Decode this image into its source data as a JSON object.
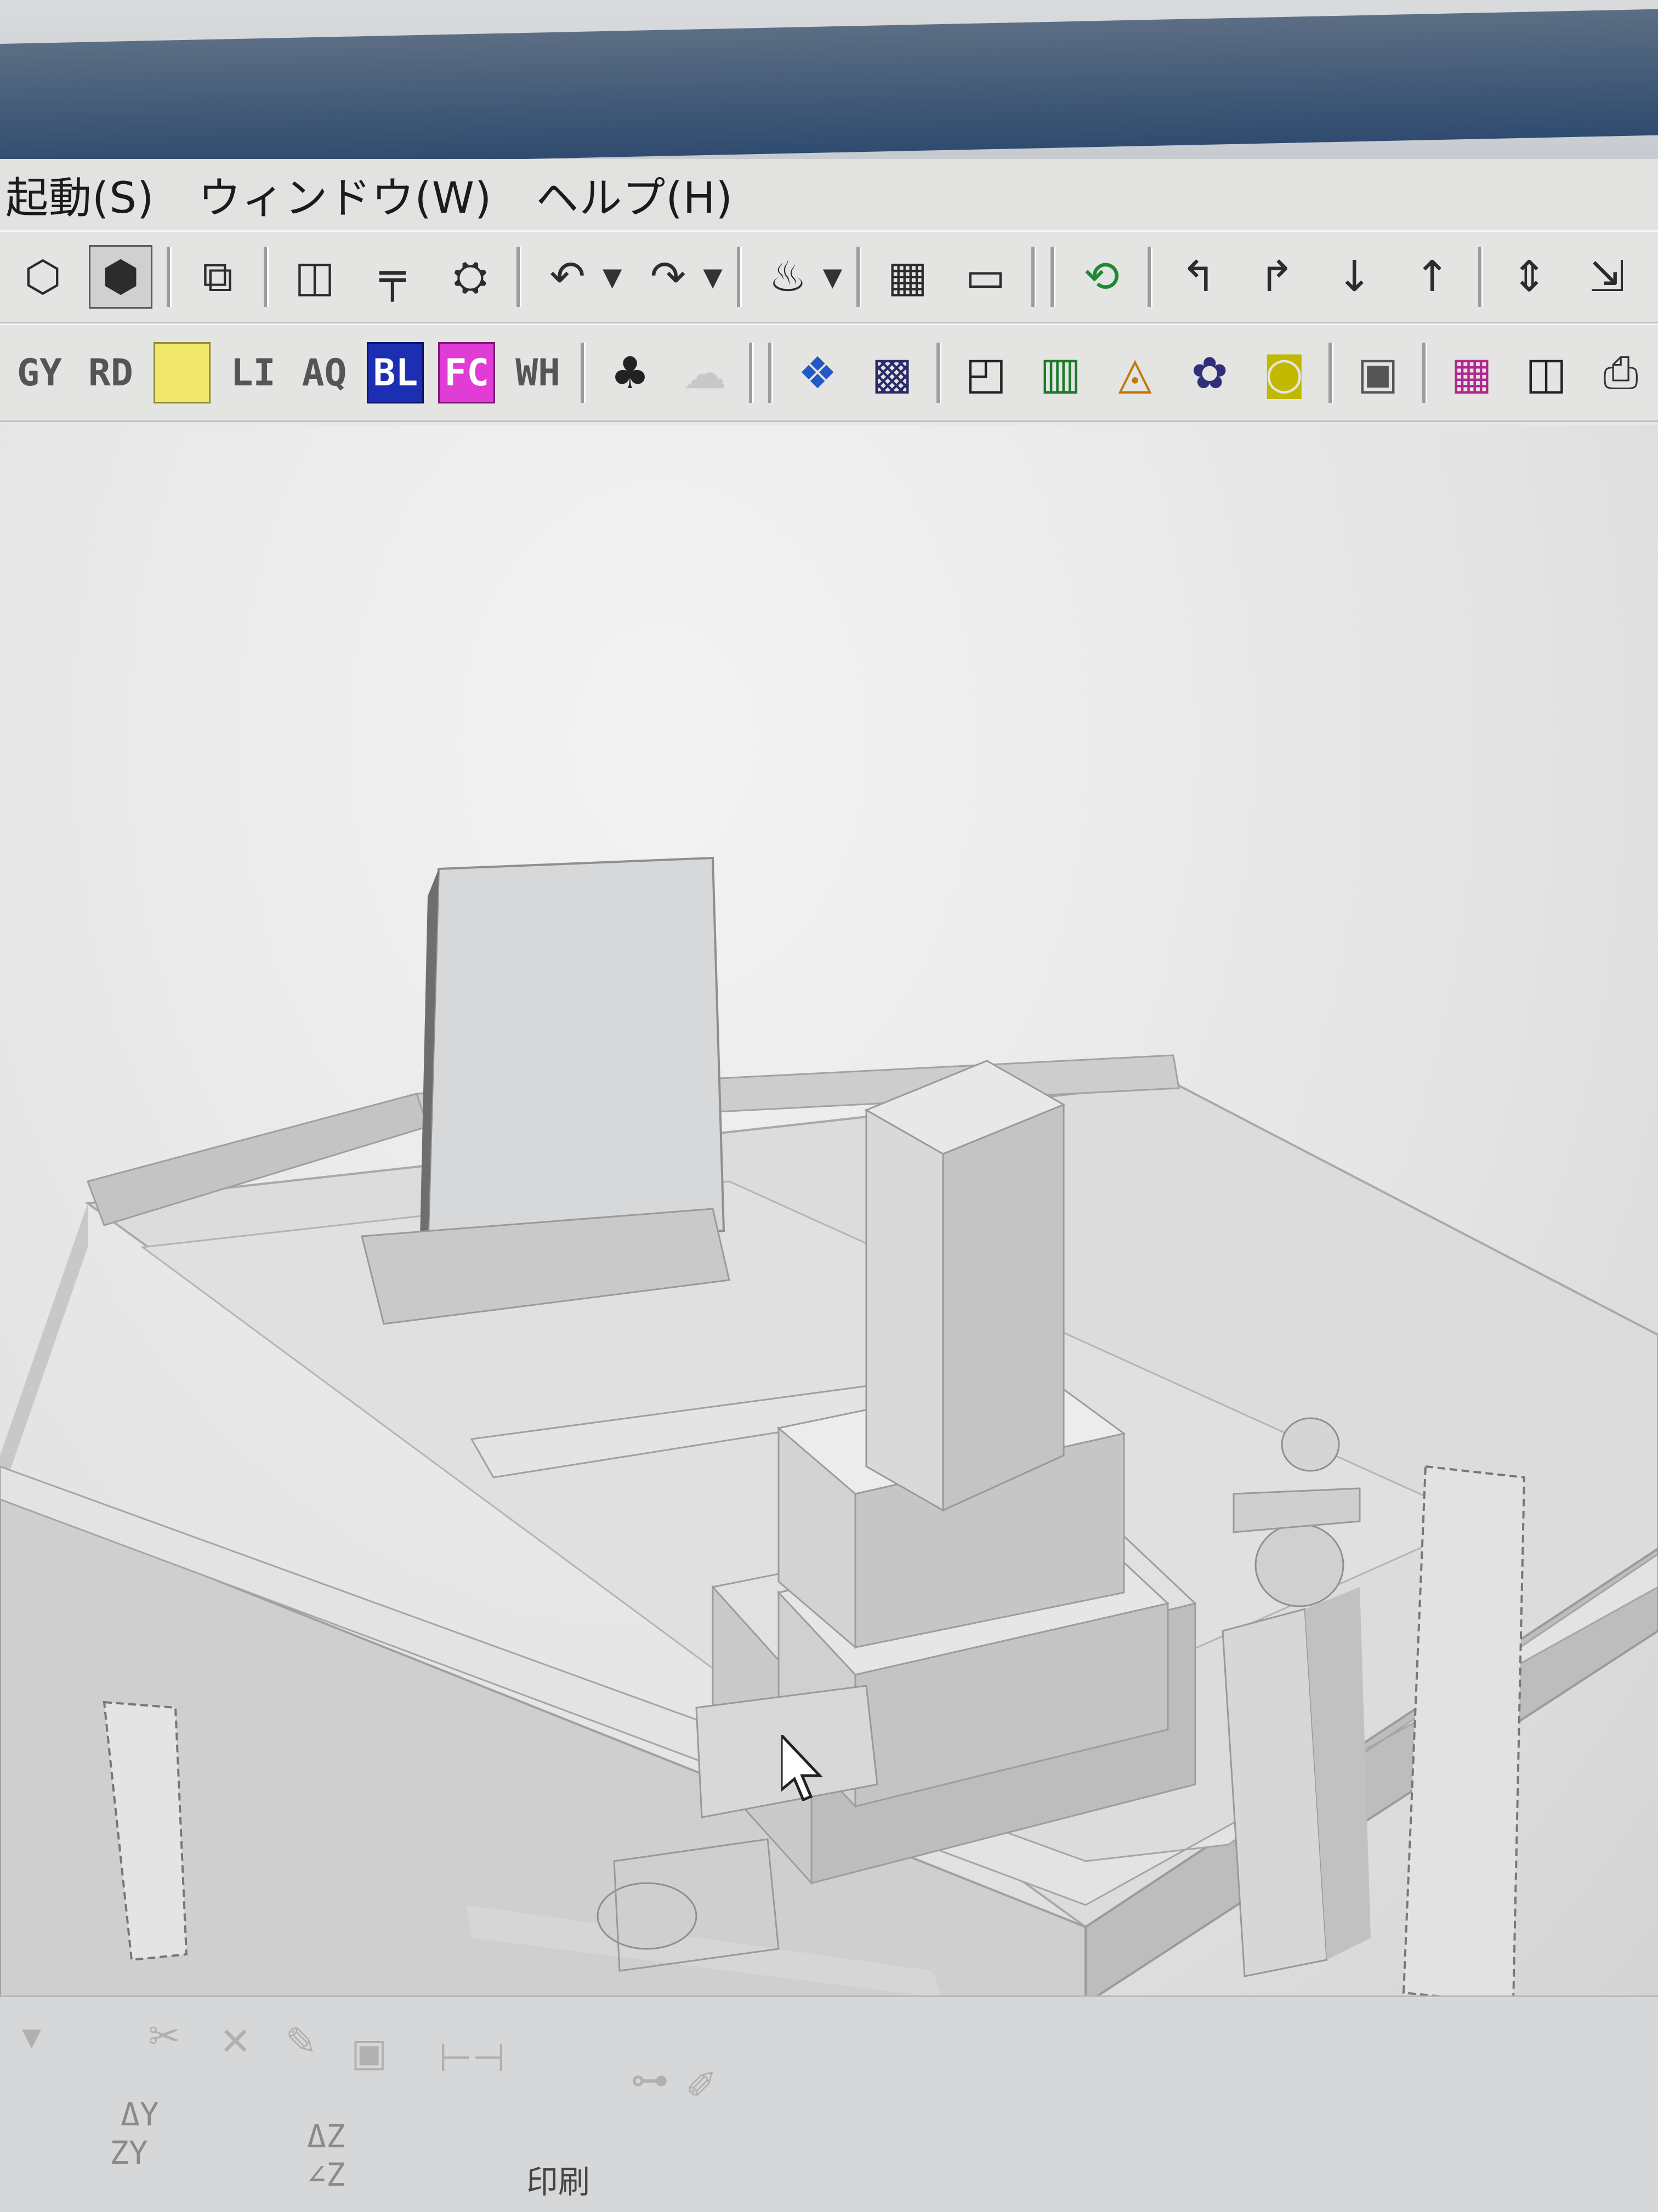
{
  "menu": {
    "items": [
      {
        "label": "起動(S)"
      },
      {
        "label": "ウィンドウ(W)"
      },
      {
        "label": "ヘルプ(H)"
      }
    ]
  },
  "toolbar_row2": {
    "view_chips": [
      "GY",
      "RD",
      "YL",
      "LI",
      "AQ",
      "BL",
      "FC",
      "WH"
    ]
  },
  "statusbar": {
    "fields": [
      "ΔY",
      "ZY",
      "ΔZ",
      "∠Z",
      "印刷"
    ]
  },
  "colors": {
    "title_bar": "#2f4b6f",
    "chip_yellow": "#f0e66a",
    "chip_blue": "#1c2fb3",
    "chip_pink": "#e23cd6"
  },
  "icons": [
    "solid-view-icon",
    "hidden-view-icon",
    "copy-icon",
    "undo-icon",
    "redo-icon",
    "light-icon",
    "layout-icon",
    "rotate-icon",
    "move-up-icon",
    "move-down-icon",
    "render-icon",
    "material-icon",
    "print-icon"
  ]
}
